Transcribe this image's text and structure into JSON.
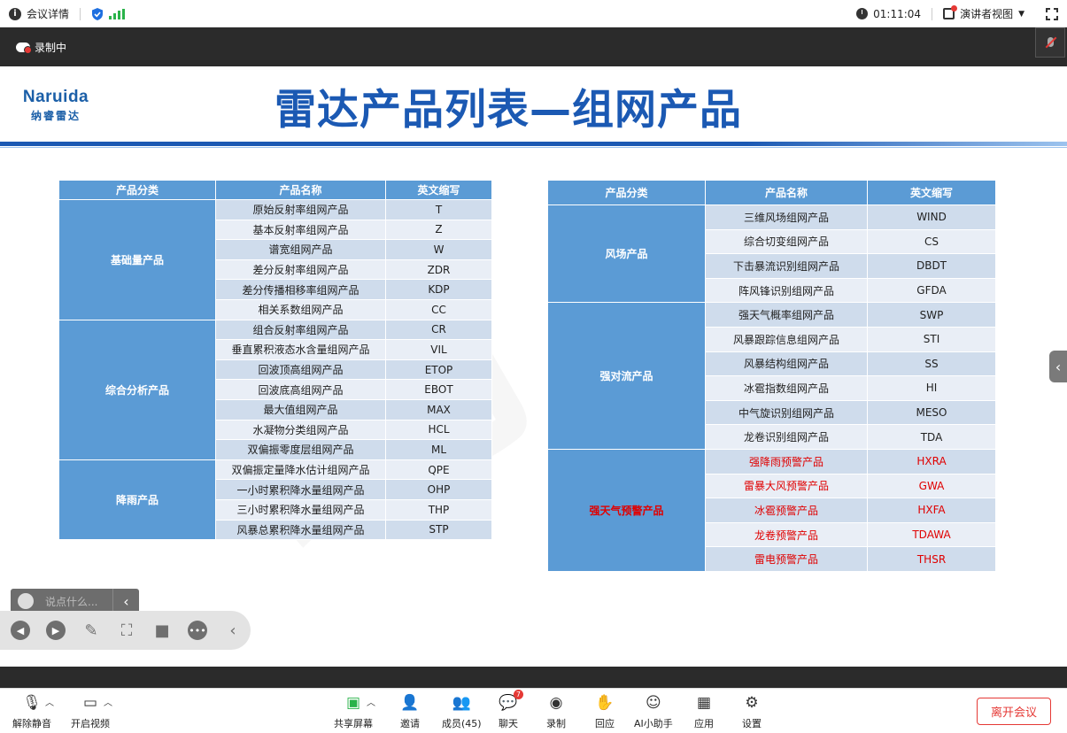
{
  "topbar": {
    "meeting_details": "会议详情",
    "timer": "01:11:04",
    "presenter_view": "演讲者视图"
  },
  "recording": {
    "label": "录制中"
  },
  "slide": {
    "logo_en": "Naruida",
    "logo_cn": "纳睿雷达",
    "title": "雷达产品列表—组网产品",
    "left_table": {
      "headers": [
        "产品分类",
        "产品名称",
        "英文缩写"
      ],
      "groups": [
        {
          "category": "基础量产品",
          "rows": [
            [
              "原始反射率组网产品",
              "T"
            ],
            [
              "基本反射率组网产品",
              "Z"
            ],
            [
              "谱宽组网产品",
              "W"
            ],
            [
              "差分反射率组网产品",
              "ZDR"
            ],
            [
              "差分传播相移率组网产品",
              "KDP"
            ],
            [
              "相关系数组网产品",
              "CC"
            ]
          ]
        },
        {
          "category": "综合分析产品",
          "rows": [
            [
              "组合反射率组网产品",
              "CR"
            ],
            [
              "垂直累积液态水含量组网产品",
              "VIL"
            ],
            [
              "回波顶高组网产品",
              "ETOP"
            ],
            [
              "回波底高组网产品",
              "EBOT"
            ],
            [
              "最大值组网产品",
              "MAX"
            ],
            [
              "水凝物分类组网产品",
              "HCL"
            ],
            [
              "双偏振零度层组网产品",
              "ML"
            ]
          ]
        },
        {
          "category": "降雨产品",
          "rows": [
            [
              "双偏振定量降水估计组网产品",
              "QPE"
            ],
            [
              "一小时累积降水量组网产品",
              "OHP"
            ],
            [
              "三小时累积降水量组网产品",
              "THP"
            ],
            [
              "风暴总累积降水量组网产品",
              "STP"
            ]
          ]
        }
      ]
    },
    "right_table": {
      "headers": [
        "产品分类",
        "产品名称",
        "英文缩写"
      ],
      "groups": [
        {
          "category": "风场产品",
          "red": false,
          "rows": [
            [
              "三维风场组网产品",
              "WIND"
            ],
            [
              "综合切变组网产品",
              "CS"
            ],
            [
              "下击暴流识别组网产品",
              "DBDT"
            ],
            [
              "阵风锋识别组网产品",
              "GFDA"
            ]
          ]
        },
        {
          "category": "强对流产品",
          "red": false,
          "rows": [
            [
              "强天气概率组网产品",
              "SWP"
            ],
            [
              "风暴跟踪信息组网产品",
              "STI"
            ],
            [
              "风暴结构组网产品",
              "SS"
            ],
            [
              "冰雹指数组网产品",
              "HI"
            ],
            [
              "中气旋识别组网产品",
              "MESO"
            ],
            [
              "龙卷识别组网产品",
              "TDA"
            ]
          ]
        },
        {
          "category": "强天气预警产品",
          "red": true,
          "rows": [
            [
              "强降雨预警产品",
              "HXRA"
            ],
            [
              "雷暴大风预警产品",
              "GWA"
            ],
            [
              "冰雹预警产品",
              "HXFA"
            ],
            [
              "龙卷预警产品",
              "TDAWA"
            ],
            [
              "雷电预警产品",
              "THSR"
            ]
          ]
        }
      ]
    }
  },
  "chat": {
    "placeholder": "说点什么..."
  },
  "toolbar": {
    "unmute": "解除静音",
    "start_video": "开启视频",
    "share_screen": "共享屏幕",
    "invite": "邀请",
    "members": "成员(45)",
    "chat": "聊天",
    "chat_badge": "7",
    "record": "录制",
    "react": "回应",
    "ai_assistant": "AI小助手",
    "apps": "应用",
    "settings": "设置",
    "leave": "离开会议"
  },
  "colors": {
    "header_blue": "#5b9bd5",
    "row_dark": "#cfdcec",
    "row_light": "#e9eef6",
    "alert_red": "#e00000",
    "title_blue": "#1b59b3"
  }
}
